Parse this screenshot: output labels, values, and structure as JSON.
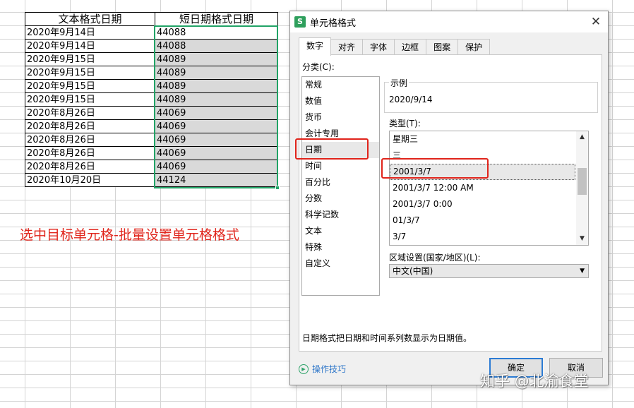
{
  "sheet": {
    "headers": [
      "文本格式日期",
      "短日期格式日期"
    ],
    "rows": [
      [
        "2020年9月14日",
        "44088"
      ],
      [
        "2020年9月14日",
        "44088"
      ],
      [
        "2020年9月15日",
        "44089"
      ],
      [
        "2020年9月15日",
        "44089"
      ],
      [
        "2020年9月15日",
        "44089"
      ],
      [
        "2020年9月15日",
        "44089"
      ],
      [
        "2020年8月26日",
        "44069"
      ],
      [
        "2020年8月26日",
        "44069"
      ],
      [
        "2020年8月26日",
        "44069"
      ],
      [
        "2020年8月26日",
        "44069"
      ],
      [
        "2020年8月26日",
        "44069"
      ],
      [
        "2020年10月20日",
        "44124"
      ]
    ],
    "annotation": "选中目标单元格-批量设置单元格格式",
    "annotation_color": "#e0241b",
    "selection_color": "#21a366"
  },
  "dialog": {
    "app_icon_letter": "S",
    "title": "单元格格式",
    "close_glyph": "✕",
    "tabs": [
      "数字",
      "对齐",
      "字体",
      "边框",
      "图案",
      "保护"
    ],
    "active_tab": "数字",
    "category_label": "分类(C):",
    "categories": [
      "常规",
      "数值",
      "货币",
      "会计专用",
      "日期",
      "时间",
      "百分比",
      "分数",
      "科学记数",
      "文本",
      "特殊",
      "自定义"
    ],
    "selected_category": "日期",
    "sample_label": "示例",
    "sample_value": "2020/9/14",
    "type_label": "类型(T):",
    "types": [
      "星期三",
      "三",
      "2001/3/7",
      "2001/3/7 12:00 AM",
      "2001/3/7 0:00",
      "01/3/7",
      "3/7"
    ],
    "selected_type": "2001/3/7",
    "locale_label": "区域设置(国家/地区)(L):",
    "locale_value": "中文(中国)",
    "description": "日期格式把日期和时间系列数显示为日期值。",
    "tips_label": "操作技巧",
    "ok_label": "确定",
    "cancel_label": "取消",
    "accent_color": "#2b7bd4"
  },
  "watermark": "知乎 @北渝食堂"
}
